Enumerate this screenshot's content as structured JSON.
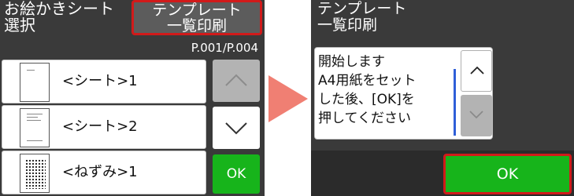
{
  "left_screen": {
    "title": "お絵かきシート\n選択",
    "template_button": "テンプレート\n一覧印刷",
    "page_counter": "P.001/P.004",
    "items": [
      {
        "label": "<シート>1",
        "thumb": "blank-sheet"
      },
      {
        "label": "<シート>2",
        "thumb": "sheet-with-lines"
      },
      {
        "label": "<ねずみ>1",
        "thumb": "mouse-drawing"
      }
    ],
    "up_button": "chevron-up-icon",
    "down_button": "chevron-down-icon",
    "ok_button": "OK"
  },
  "right_screen": {
    "title": "テンプレート\n一覧印刷",
    "message": "開始します\nA4用紙をセット\nした後、[OK]を\n押してください",
    "up_button": "chevron-up-icon",
    "down_button": "chevron-down-icon",
    "ok_button": "OK"
  },
  "colors": {
    "background": "#3a3a3a",
    "ok_green": "#17b41b",
    "highlight_red": "#d11a1a",
    "arrow": "#f07f73",
    "scrollbar_blue": "#2f5fd8"
  }
}
